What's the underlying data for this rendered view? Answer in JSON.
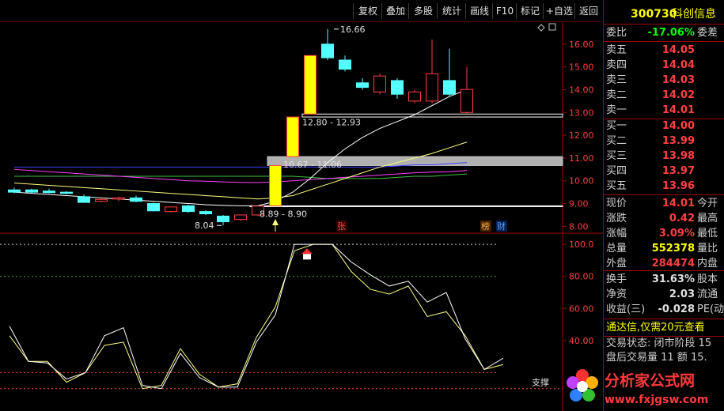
{
  "toolbar": {
    "buttons": [
      "复权",
      "叠加",
      "多股",
      "统计",
      "画线",
      "F10",
      "标记",
      "+自选",
      "返回"
    ]
  },
  "stock": {
    "code": "300730",
    "name": "科创信息"
  },
  "order_book": {
    "weibi_label": "委比",
    "weibi_value": "-17.06%",
    "weicha_label": "委差",
    "asks": [
      {
        "label": "卖五",
        "price": "14.05"
      },
      {
        "label": "卖四",
        "price": "14.04"
      },
      {
        "label": "卖三",
        "price": "14.03"
      },
      {
        "label": "卖二",
        "price": "14.02"
      },
      {
        "label": "卖一",
        "price": "14.01"
      }
    ],
    "bids": [
      {
        "label": "买一",
        "price": "14.00"
      },
      {
        "label": "买二",
        "price": "13.99"
      },
      {
        "label": "买三",
        "price": "13.98"
      },
      {
        "label": "买四",
        "price": "13.97"
      },
      {
        "label": "买五",
        "price": "13.96"
      }
    ]
  },
  "quote": [
    {
      "label": "现价",
      "value": "14.01",
      "extra": "今开",
      "color": "#ff4040"
    },
    {
      "label": "涨跌",
      "value": "0.42",
      "extra": "最高",
      "color": "#ff4040"
    },
    {
      "label": "涨幅",
      "value": "3.09%",
      "extra": "最低",
      "color": "#ff4040"
    },
    {
      "label": "总量",
      "value": "552378",
      "extra": "量比",
      "color": "#ffff00"
    },
    {
      "label": "外盘",
      "value": "284474",
      "extra": "内盘",
      "color": "#ff4040"
    }
  ],
  "stats": [
    {
      "label": "换手",
      "value": "31.63%",
      "extra": "股本"
    },
    {
      "label": "净资",
      "value": "2.03",
      "extra": "流通"
    },
    {
      "label": "收益(三)",
      "value": "-0.028",
      "extra": "PE(动"
    }
  ],
  "messages": {
    "promo": "通达信,仅需20元查看",
    "trade_state": "交易状态: 闭市阶段 15",
    "after_hours": "盘后交易量 11 额 15."
  },
  "watermark": {
    "brand": "分析家公式网",
    "url": "www.fxjgsw.com"
  },
  "main_chart": {
    "price_ticks": [
      "16.00",
      "15.00",
      "14.00",
      "13.00",
      "12.00",
      "11.00",
      "10.00",
      "9.00",
      "8.00"
    ],
    "annotations": {
      "high": "16.66",
      "low": "8.04",
      "gap1": "8.89 - 8.90",
      "gap2": "10.67 - 11.06",
      "gap3": "12.80 - 12.93"
    },
    "markers": {
      "zhang": "张",
      "bang": "榜",
      "cai": "财"
    },
    "colors": {
      "up": "#ff4040",
      "down": "#54ffff",
      "limit": "#ffff00"
    }
  },
  "sub_chart": {
    "ticks": [
      "100.0",
      "80.00",
      "60.00",
      "40.00"
    ],
    "label_support": "支撑"
  },
  "chart_data": {
    "type": "candlestick",
    "candles": [
      {
        "o": 9.6,
        "h": 9.7,
        "l": 9.45,
        "c": 9.5
      },
      {
        "o": 9.6,
        "h": 9.65,
        "l": 9.45,
        "c": 9.5
      },
      {
        "o": 9.55,
        "h": 9.65,
        "l": 9.45,
        "c": 9.48
      },
      {
        "o": 9.5,
        "h": 9.55,
        "l": 9.4,
        "c": 9.45
      },
      {
        "o": 9.3,
        "h": 9.4,
        "l": 9.05,
        "c": 9.05
      },
      {
        "o": 9.1,
        "h": 9.25,
        "l": 9.05,
        "c": 9.18
      },
      {
        "o": 9.2,
        "h": 9.3,
        "l": 9.1,
        "c": 9.25
      },
      {
        "o": 9.25,
        "h": 9.35,
        "l": 9.05,
        "c": 9.1
      },
      {
        "o": 9.0,
        "h": 9.05,
        "l": 8.65,
        "c": 8.68
      },
      {
        "o": 8.65,
        "h": 8.85,
        "l": 8.6,
        "c": 8.85
      },
      {
        "o": 8.9,
        "h": 8.95,
        "l": 8.6,
        "c": 8.65
      },
      {
        "o": 8.65,
        "h": 8.7,
        "l": 8.5,
        "c": 8.55
      },
      {
        "o": 8.45,
        "h": 8.5,
        "l": 8.04,
        "c": 8.2
      },
      {
        "o": 8.3,
        "h": 8.5,
        "l": 8.25,
        "c": 8.5
      },
      {
        "o": 8.5,
        "h": 8.9,
        "l": 8.45,
        "c": 8.89
      },
      {
        "o": 8.9,
        "h": 10.67,
        "l": 8.9,
        "c": 10.67
      },
      {
        "o": 11.06,
        "h": 12.8,
        "l": 11.06,
        "c": 12.8
      },
      {
        "o": 12.93,
        "h": 15.5,
        "l": 12.93,
        "c": 15.5
      },
      {
        "o": 16.0,
        "h": 16.66,
        "l": 15.3,
        "c": 15.4
      },
      {
        "o": 15.3,
        "h": 15.5,
        "l": 14.8,
        "c": 14.9
      },
      {
        "o": 14.3,
        "h": 14.5,
        "l": 14.0,
        "c": 14.1
      },
      {
        "o": 13.9,
        "h": 14.7,
        "l": 13.8,
        "c": 14.6
      },
      {
        "o": 14.4,
        "h": 14.5,
        "l": 13.6,
        "c": 13.8
      },
      {
        "o": 13.5,
        "h": 14.0,
        "l": 13.4,
        "c": 13.9
      },
      {
        "o": 13.5,
        "h": 16.2,
        "l": 13.4,
        "c": 14.7
      },
      {
        "o": 14.4,
        "h": 15.8,
        "l": 13.7,
        "c": 13.8
      },
      {
        "o": 13.0,
        "h": 15.0,
        "l": 12.9,
        "c": 14.01
      }
    ],
    "ma_white": [
      9.5,
      9.45,
      9.4,
      9.35,
      9.3,
      9.25,
      9.2,
      9.15,
      9.1,
      9.05,
      9.0,
      8.95,
      8.92,
      8.9,
      8.9,
      9.1,
      9.5,
      10.1,
      10.8,
      11.4,
      11.9,
      12.3,
      12.6,
      12.9,
      13.3,
      13.7,
      14.0
    ],
    "ma_yellow": [
      9.9,
      9.85,
      9.8,
      9.75,
      9.7,
      9.65,
      9.6,
      9.55,
      9.5,
      9.45,
      9.4,
      9.35,
      9.3,
      9.25,
      9.2,
      9.25,
      9.35,
      9.6,
      9.85,
      10.1,
      10.35,
      10.6,
      10.8,
      11.0,
      11.2,
      11.45,
      11.7
    ],
    "ma_magenta": [
      10.5,
      10.45,
      10.4,
      10.35,
      10.3,
      10.25,
      10.2,
      10.15,
      10.1,
      10.05,
      10.0,
      9.98,
      9.95,
      9.93,
      9.92,
      9.95,
      10.0,
      10.05,
      10.1,
      10.15,
      10.2,
      10.25,
      10.3,
      10.35,
      10.38,
      10.4,
      10.45
    ],
    "ma_green": [
      10.2,
      10.2,
      10.2,
      10.2,
      10.2,
      10.2,
      10.2,
      10.2,
      10.2,
      10.2,
      10.2,
      10.2,
      10.2,
      10.2,
      10.2,
      10.2,
      10.2,
      10.15,
      10.1,
      10.1,
      10.1,
      10.1,
      10.15,
      10.2,
      10.2,
      10.25,
      10.3
    ],
    "ma_blue": [
      10.6,
      10.6,
      10.6,
      10.6,
      10.6,
      10.6,
      10.6,
      10.6,
      10.6,
      10.6,
      10.6,
      10.6,
      10.6,
      10.6,
      10.6,
      10.6,
      10.6,
      10.6,
      10.6,
      10.6,
      10.6,
      10.6,
      10.65,
      10.7,
      10.7,
      10.75,
      10.8
    ],
    "zones": [
      [
        12.8,
        12.93
      ],
      [
        10.67,
        11.06
      ],
      [
        8.89,
        8.9
      ]
    ],
    "ylim": [
      7.7,
      17.0
    ],
    "osc_white": [
      49,
      27,
      26,
      16,
      20,
      43,
      48,
      12,
      10,
      32,
      17,
      11,
      11,
      39,
      56,
      100,
      100,
      100,
      89,
      81,
      74,
      77,
      64,
      70,
      41,
      22,
      29
    ],
    "osc_yellow": [
      43,
      27,
      27,
      14,
      20,
      37,
      39,
      10,
      12,
      35,
      19,
      11,
      13,
      42,
      61,
      96,
      100,
      100,
      83,
      72,
      69,
      74,
      55,
      58,
      43,
      22,
      25
    ],
    "osc_ylim": [
      0,
      106
    ]
  }
}
